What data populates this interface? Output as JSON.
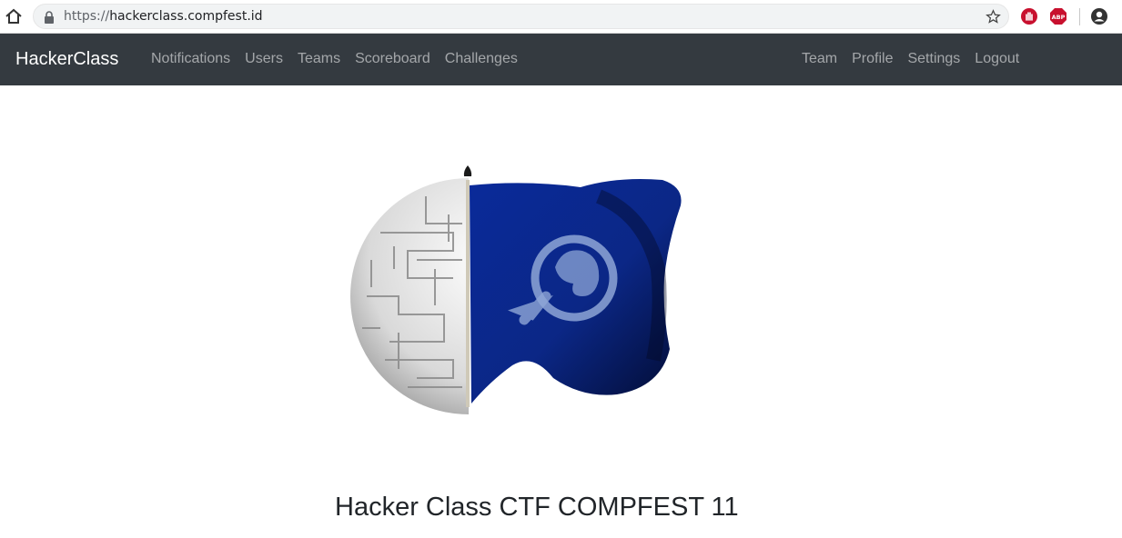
{
  "browser": {
    "url_scheme": "https://",
    "url_host": "hackerclass.compfest.id",
    "icons": [
      "home-icon",
      "lock-icon",
      "star-icon",
      "hand-stop-icon",
      "abp-icon",
      "account-icon"
    ],
    "abp_label": "ABP"
  },
  "navbar": {
    "brand": "HackerClass",
    "left_links": [
      "Notifications",
      "Users",
      "Teams",
      "Scoreboard",
      "Challenges"
    ],
    "right_links": [
      "Team",
      "Profile",
      "Settings",
      "Logout"
    ],
    "background": "#343a40"
  },
  "main": {
    "title": "Hacker Class CTF COMPFEST 11",
    "logo_colors": {
      "flag": "#0b2a8c",
      "sphere": "#e8e8e8",
      "emblem": "#8ea6d6"
    }
  }
}
